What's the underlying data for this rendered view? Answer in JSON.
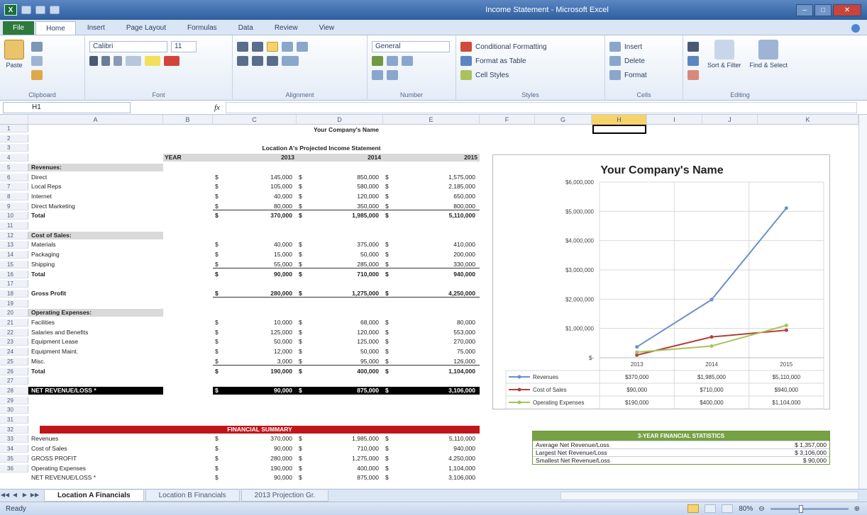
{
  "window": {
    "title": "Income Statement  -  Microsoft Excel",
    "app_icon": "X"
  },
  "ribbon_tabs": [
    "File",
    "Home",
    "Insert",
    "Page Layout",
    "Formulas",
    "Data",
    "Review",
    "View"
  ],
  "ribbon": {
    "paste_label": "Paste",
    "clipboard_label": "Clipboard",
    "font_name": "Calibri",
    "font_size": "11",
    "font_label": "Font",
    "alignment_label": "Alignment",
    "number_format": "General",
    "number_label": "Number",
    "conditional_formatting": "Conditional Formatting",
    "format_as_table": "Format as Table",
    "cell_styles": "Cell Styles",
    "styles_label": "Styles",
    "insert": "Insert",
    "delete": "Delete",
    "format": "Format",
    "cells_label": "Cells",
    "sort_filter": "Sort & Filter",
    "find_select": "Find & Select",
    "editing_label": "Editing"
  },
  "formula_bar": {
    "name_box": "H1",
    "fx": "fx",
    "formula": ""
  },
  "columns": [
    "A",
    "B",
    "C",
    "D",
    "E",
    "F",
    "G",
    "H",
    "I",
    "J",
    "K"
  ],
  "rows": [
    "1",
    "2",
    "3",
    "4",
    "5",
    "6",
    "7",
    "8",
    "9",
    "10",
    "11",
    "12",
    "13",
    "14",
    "15",
    "16",
    "17",
    "18",
    "19",
    "20",
    "21",
    "22",
    "23",
    "24",
    "25",
    "26",
    "27",
    "28",
    "29",
    "30",
    "31",
    "32",
    "33",
    "34",
    "35",
    "36"
  ],
  "sheet": {
    "company_name": "Your Company's Name",
    "statement_title": "Location A's Projected Income Statement",
    "year_label": "YEAR",
    "years": [
      "2013",
      "2014",
      "2015"
    ],
    "revenues_header": "Revenues:",
    "revenues": [
      {
        "label": "Direct",
        "values": [
          "145,000",
          "850,000",
          "1,575,000"
        ]
      },
      {
        "label": "Local Reps",
        "values": [
          "105,000",
          "580,000",
          "2,185,000"
        ]
      },
      {
        "label": "Internet",
        "values": [
          "40,000",
          "120,000",
          "650,000"
        ]
      },
      {
        "label": "Direct Marketing",
        "values": [
          "80,000",
          "350,000",
          "800,000"
        ]
      }
    ],
    "revenues_total": {
      "label": "Total",
      "values": [
        "370,000",
        "1,985,000",
        "5,110,000"
      ]
    },
    "cos_header": "Cost of Sales:",
    "cos": [
      {
        "label": "Materials",
        "values": [
          "40,000",
          "375,000",
          "410,000"
        ]
      },
      {
        "label": "Packaging",
        "values": [
          "15,000",
          "50,000",
          "200,000"
        ]
      },
      {
        "label": "Shipping",
        "values": [
          "55,000",
          "285,000",
          "330,000"
        ]
      }
    ],
    "cos_total": {
      "label": "Total",
      "values": [
        "90,000",
        "710,000",
        "940,000"
      ]
    },
    "gross_profit": {
      "label": "Gross Profit",
      "values": [
        "280,000",
        "1,275,000",
        "4,250,000"
      ]
    },
    "opex_header": "Operating Expenses:",
    "opex": [
      {
        "label": "Facilities",
        "values": [
          "10,000",
          "68,000",
          "80,000"
        ]
      },
      {
        "label": "Salaries and Benefits",
        "values": [
          "125,000",
          "120,000",
          "553,000"
        ]
      },
      {
        "label": "Equipment Lease",
        "values": [
          "50,000",
          "125,000",
          "270,000"
        ]
      },
      {
        "label": "Equipment Maint.",
        "values": [
          "12,000",
          "50,000",
          "75,000"
        ]
      },
      {
        "label": "Misc.",
        "values": [
          "3,000",
          "95,000",
          "126,000"
        ]
      }
    ],
    "opex_total": {
      "label": "Total",
      "values": [
        "190,000",
        "400,000",
        "1,104,000"
      ]
    },
    "net_revenue": {
      "label": "NET REVENUE/LOSS *",
      "values": [
        "90,000",
        "875,000",
        "3,106,000"
      ]
    },
    "currency": "$",
    "financial_summary_title": "FINANCIAL SUMMARY",
    "summary_rows": [
      {
        "label": "Revenues",
        "values": [
          "370,000",
          "1,985,000",
          "5,110,000"
        ]
      },
      {
        "label": "Cost of Sales",
        "values": [
          "90,000",
          "710,000",
          "940,000"
        ]
      },
      {
        "label": "GROSS PROFIT",
        "values": [
          "280,000",
          "1,275,000",
          "4,250,000"
        ]
      },
      {
        "label": "Operating Expenses",
        "values": [
          "190,000",
          "400,000",
          "1,104,000"
        ]
      },
      {
        "label": "NET REVENUE/LOSS *",
        "values": [
          "90,000",
          "875,000",
          "3,106,000"
        ]
      }
    ]
  },
  "chart_data": {
    "type": "line",
    "title": "Your Company's Name",
    "categories": [
      "2013",
      "2014",
      "2015"
    ],
    "yticks": [
      "$6,000,000",
      "$5,000,000",
      "$4,000,000",
      "$3,000,000",
      "$2,000,000",
      "$1,000,000",
      "$-"
    ],
    "ylim": [
      0,
      6000000
    ],
    "grid": true,
    "series": [
      {
        "name": "Revenues",
        "values": [
          370000,
          1985000,
          5110000
        ],
        "labels": [
          "$370,000",
          "$1,985,000",
          "$5,110,000"
        ],
        "color": "#6d8fc9"
      },
      {
        "name": "Cost of Sales",
        "values": [
          90000,
          710000,
          940000
        ],
        "labels": [
          "$90,000",
          "$710,000",
          "$940,000"
        ],
        "color": "#b2403a"
      },
      {
        "name": "Operating Expenses",
        "values": [
          190000,
          400000,
          1104000
        ],
        "labels": [
          "$190,000",
          "$400,000",
          "$1,104,000"
        ],
        "color": "#a9c25a"
      }
    ]
  },
  "stats": {
    "title": "3-YEAR FINANCIAL STATISTICS",
    "rows": [
      {
        "label": "Average Net Revenue/Loss",
        "value": "$ 1,357,000"
      },
      {
        "label": "Largest Net Revenue/Loss",
        "value": "$ 3,106,000"
      },
      {
        "label": "Smallest Net Revenue/Loss",
        "value": "$       90,000"
      }
    ]
  },
  "sheet_tabs": [
    "Location A Financials",
    "Location B Financials",
    "2013 Projection Gr."
  ],
  "status": {
    "ready": "Ready",
    "zoom": "80%"
  }
}
